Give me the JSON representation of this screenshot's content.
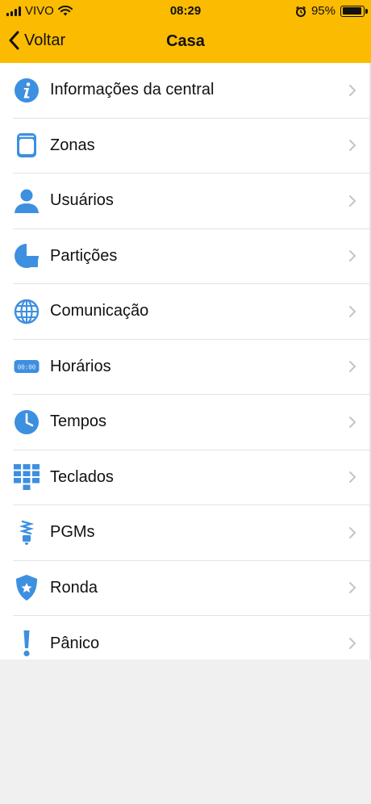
{
  "status_bar": {
    "carrier": "VIVO",
    "time": "08:29",
    "battery_percent": "95%",
    "battery_level": 0.95
  },
  "nav": {
    "back_label": "Voltar",
    "title": "Casa"
  },
  "colors": {
    "accent": "#fbbb00",
    "icon_blue": "#3d8fe0"
  },
  "menu": {
    "items": [
      {
        "label": "Informações da central",
        "icon": "info-icon"
      },
      {
        "label": "Zonas",
        "icon": "sensor-icon"
      },
      {
        "label": "Usuários",
        "icon": "user-icon"
      },
      {
        "label": "Partições",
        "icon": "partition-pie-icon"
      },
      {
        "label": "Comunicação",
        "icon": "globe-icon"
      },
      {
        "label": "Horários",
        "icon": "digital-clock-icon"
      },
      {
        "label": "Tempos",
        "icon": "clock-icon"
      },
      {
        "label": "Teclados",
        "icon": "keypad-icon"
      },
      {
        "label": "PGMs",
        "icon": "bulb-icon"
      },
      {
        "label": "Ronda",
        "icon": "shield-star-icon"
      },
      {
        "label": "Pânico",
        "icon": "exclamation-icon"
      }
    ],
    "digital_clock_text": "00:00"
  }
}
